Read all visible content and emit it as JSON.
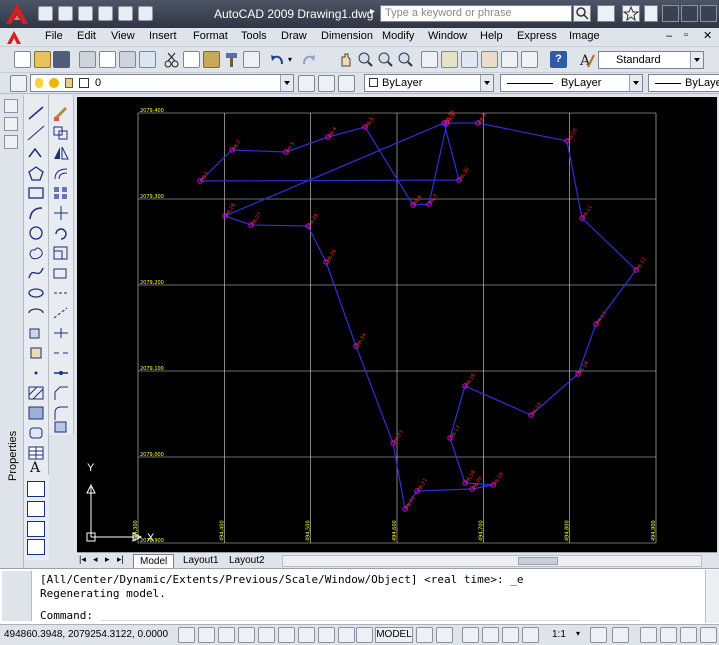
{
  "window": {
    "title": "AutoCAD 2009  Drawing1.dwg",
    "search_placeholder": "Type a keyword or phrase"
  },
  "menu": [
    "File",
    "Edit",
    "View",
    "Insert",
    "Format",
    "Tools",
    "Draw",
    "Dimension",
    "Modify",
    "Window",
    "Help",
    "Express",
    "Image"
  ],
  "toolbar": {
    "text_style": "Standard",
    "layer_value": "0",
    "color": "ByLayer",
    "linetype": "ByLayer",
    "lineweight": "ByLayer"
  },
  "side_palette": {
    "label": "Properties"
  },
  "drawing": {
    "y_grid_labels": [
      "2079,400",
      "2079,300",
      "2079,200",
      "2079,100",
      "2079,000",
      "2078,900"
    ],
    "x_grid_labels": [
      "494,300",
      "494,400",
      "494,500",
      "494,600",
      "494,700",
      "494,800",
      "494,900"
    ],
    "point_labels": [
      "PR-1",
      "PR-2",
      "PR-3",
      "PR-4",
      "PR-5",
      "PR-6",
      "PR-7",
      "PR-8",
      "PR-9",
      "PR-10",
      "PR-11",
      "PR-12",
      "PR-13",
      "PR-14",
      "PR-15",
      "PR-16",
      "PR-17",
      "PR-18",
      "PR-19",
      "PR-20",
      "PR-21",
      "PR-22",
      "PR-23",
      "PR-24",
      "PR-25",
      "PR-26",
      "PR-27",
      "PR-28",
      "PR-29",
      "PR-30",
      "PR-31"
    ],
    "ucs_x": "X",
    "ucs_y": "Y",
    "colors": {
      "background": "#000000",
      "polyline": "#2f2fd8",
      "grid": "#d8d8d8",
      "label": "#ff2a2a",
      "grid_label": "#ffff33",
      "vertex": "#d400d4"
    }
  },
  "tabs": [
    {
      "label": "Model",
      "active": true
    },
    {
      "label": "Layout1",
      "active": false
    },
    {
      "label": "Layout2",
      "active": false
    }
  ],
  "command": {
    "history": [
      "[All/Center/Dynamic/Extents/Previous/Scale/Window/Object] <real time>: _e",
      "Regenerating model."
    ],
    "prompt": "Command:"
  },
  "status": {
    "coordinates": "494860.3948, 2079254.3122, 0.0000",
    "model_label": "MODEL",
    "annotation_scale": "1:1"
  }
}
